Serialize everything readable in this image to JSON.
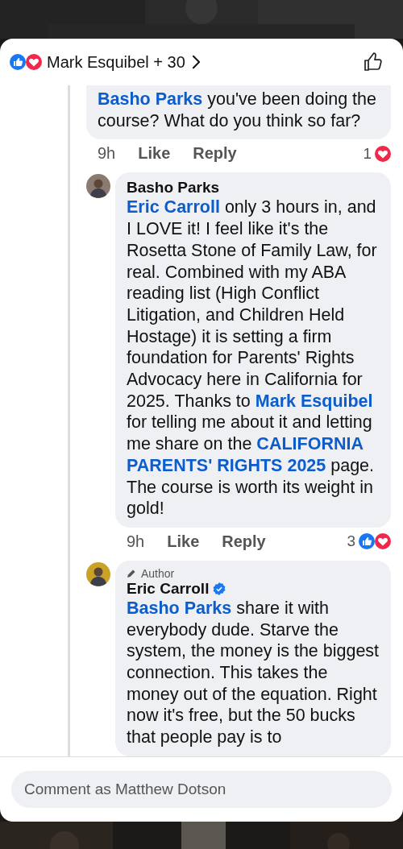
{
  "header": {
    "reactions": [
      {
        "kind": "like"
      },
      {
        "kind": "love"
      }
    ],
    "reactors": "Mark Esquibel + 30"
  },
  "comments": [
    {
      "avatar": false,
      "text": "**Basho Parks** you've been doing the course? What do you think so far?",
      "time": "9h",
      "like": "Like",
      "reply": "Reply",
      "reaction_count": "1",
      "reactions": [
        {
          "kind": "love"
        }
      ]
    },
    {
      "avatar": true,
      "author": "Basho Parks",
      "text": "**Eric Carroll** only 3 hours in, and I LOVE it! I feel like it's the Rosetta Stone of Family Law, for real. Combined with my ABA reading list (High Conflict Litigation, and Children Held Hostage) it is setting a firm foundation for Parents' Rights Advocacy here in California for 2025. Thanks to **Mark Esquibel** for telling me about it and letting me share on the **CALIFORNIA PARENTS' RIGHTS 2025** page. The course is worth its weight in gold!",
      "time": "9h",
      "like": "Like",
      "reply": "Reply",
      "reaction_count": "3",
      "reactions": [
        {
          "kind": "like"
        },
        {
          "kind": "love"
        }
      ]
    },
    {
      "avatar": true,
      "badge": "Author",
      "author": "Eric Carroll",
      "verified": true,
      "text": "**Basho Parks** share it with everybody dude. Starve the system, the money is the biggest connection. This takes the money out of the equation. Right now it's free, but the 50 bucks that people pay is to"
    }
  ],
  "composer": {
    "placeholder": "Comment as Matthew Dotson"
  }
}
